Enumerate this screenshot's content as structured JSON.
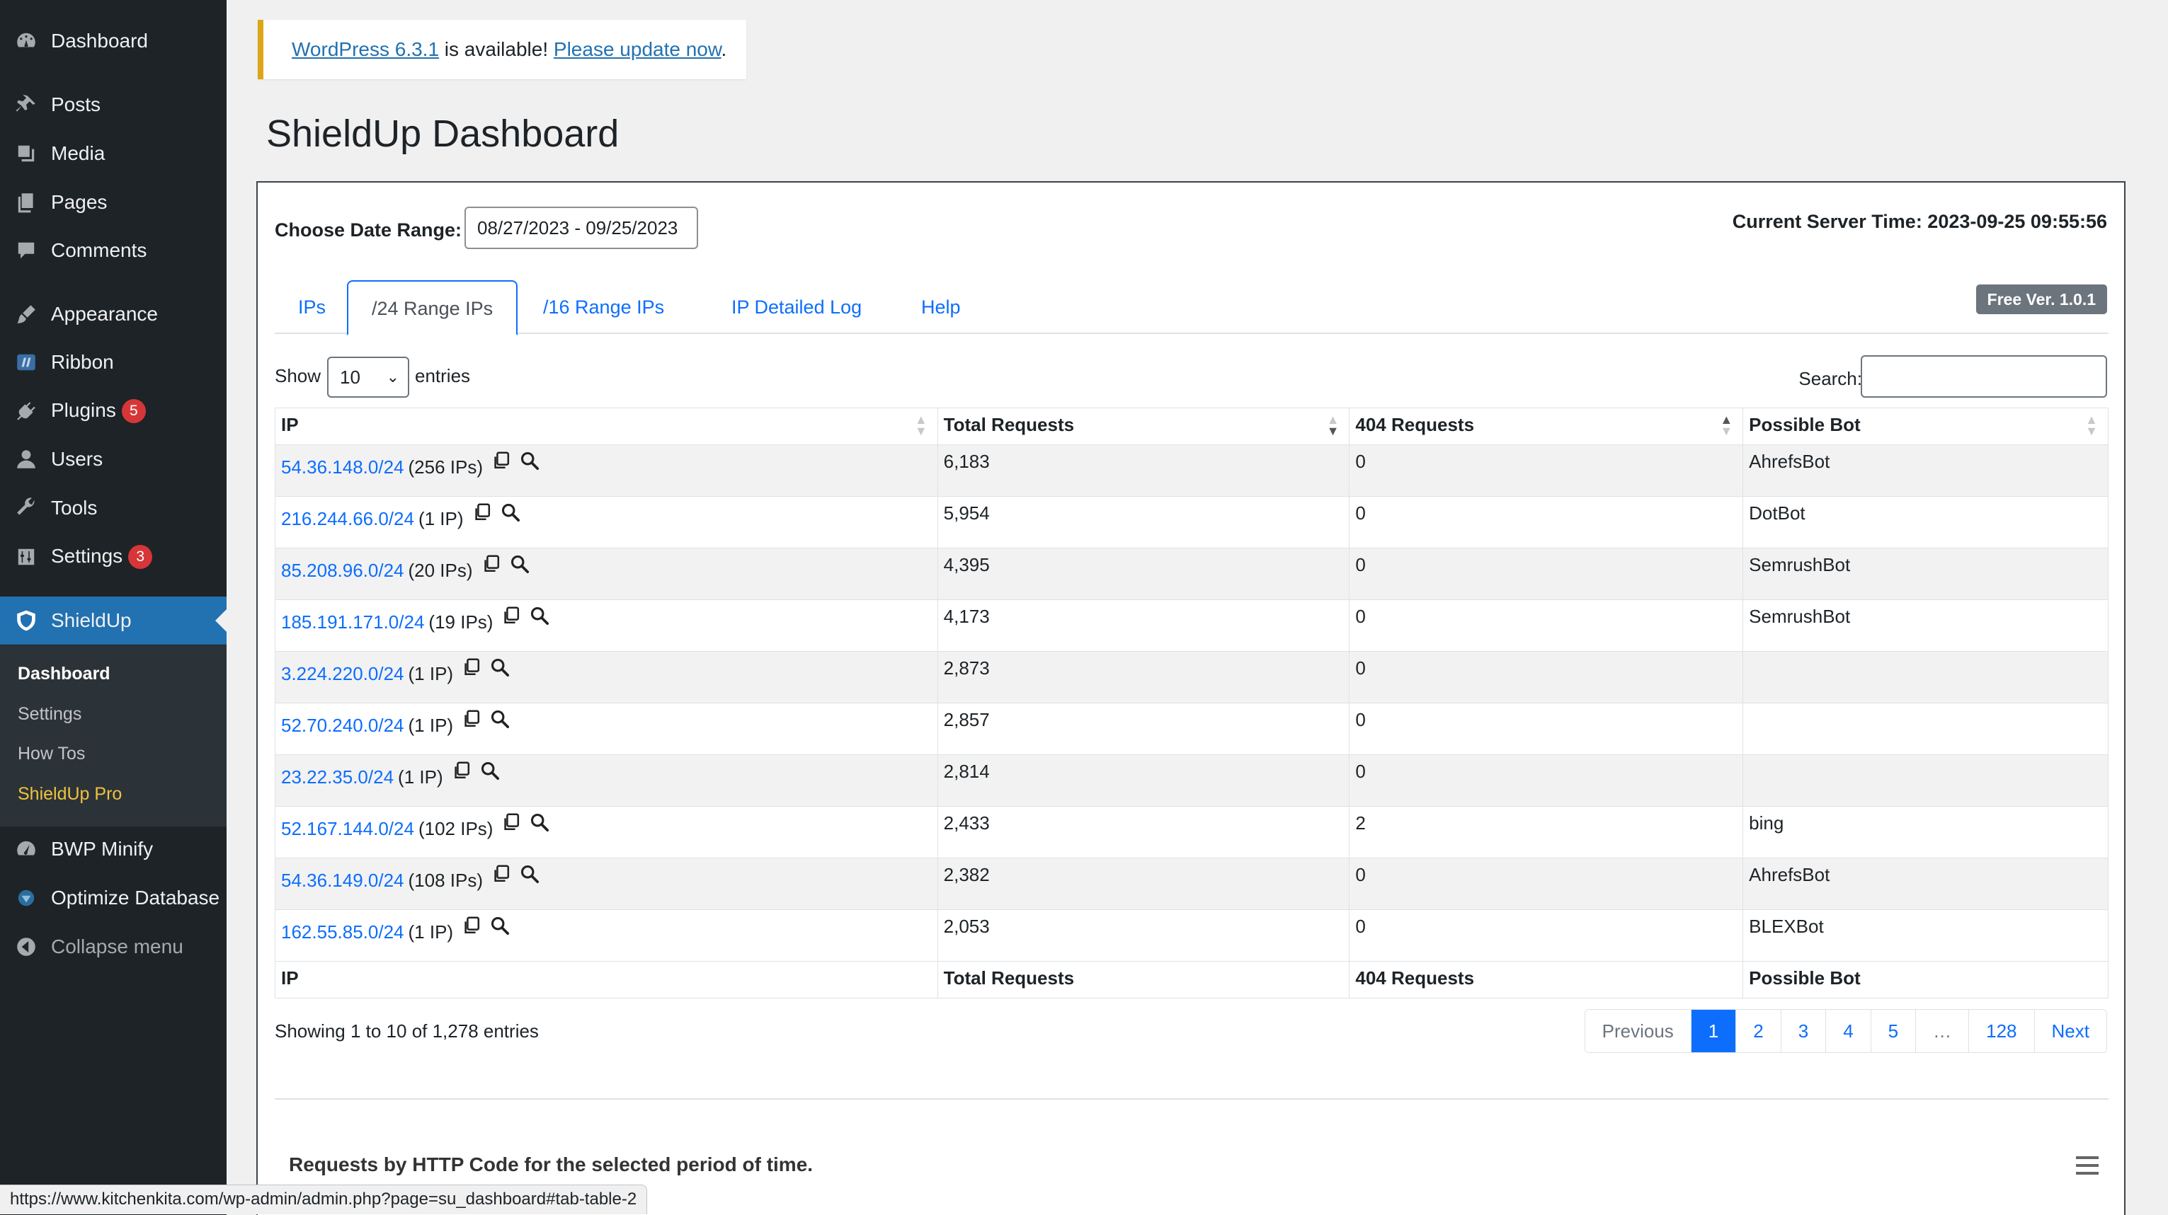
{
  "sidebar": {
    "items": [
      {
        "label": "Dashboard",
        "icon": "dashboard-icon"
      },
      {
        "label": "Posts",
        "icon": "pin-icon"
      },
      {
        "label": "Media",
        "icon": "media-icon"
      },
      {
        "label": "Pages",
        "icon": "pages-icon"
      },
      {
        "label": "Comments",
        "icon": "comment-icon"
      },
      {
        "label": "Appearance",
        "icon": "brush-icon"
      },
      {
        "label": "Ribbon",
        "icon": "ribbon-icon"
      },
      {
        "label": "Plugins",
        "icon": "plugin-icon",
        "badge": "5"
      },
      {
        "label": "Users",
        "icon": "user-icon"
      },
      {
        "label": "Tools",
        "icon": "wrench-icon"
      },
      {
        "label": "Settings",
        "icon": "sliders-icon",
        "badge": "3"
      },
      {
        "label": "ShieldUp",
        "icon": "shield-icon"
      },
      {
        "label": "BWP Minify",
        "icon": "gauge-icon"
      },
      {
        "label": "Optimize Database",
        "icon": "database-icon"
      },
      {
        "label": "Collapse menu",
        "icon": "collapse-icon"
      }
    ],
    "submenu": [
      "Dashboard",
      "Settings",
      "How Tos",
      "ShieldUp Pro"
    ]
  },
  "notice": {
    "version_link": "WordPress 6.3.1",
    "middle": " is available! ",
    "update_link": "Please update now",
    "end": "."
  },
  "page_title": "ShieldUp Dashboard",
  "controls": {
    "date_label": "Choose Date Range:",
    "date_value": "08/27/2023 - 09/25/2023",
    "server_time": "Current Server Time: 2023-09-25 09:55:56",
    "version_badge": "Free Ver. 1.0.1",
    "show_label": "Show",
    "entries_value": "10",
    "entries_label": "entries",
    "search_label": "Search:"
  },
  "tabs": [
    "IPs",
    "/24 Range IPs",
    "/16 Range IPs",
    "IP Detailed Log",
    "Help"
  ],
  "table": {
    "headers": [
      "IP",
      "Total Requests",
      "404 Requests",
      "Possible Bot"
    ],
    "rows": [
      {
        "ip": "54.36.148.0/24",
        "count": "(256 IPs)",
        "total": "6,183",
        "r404": "0",
        "bot": "AhrefsBot"
      },
      {
        "ip": "216.244.66.0/24",
        "count": "(1 IP)",
        "total": "5,954",
        "r404": "0",
        "bot": "DotBot"
      },
      {
        "ip": "85.208.96.0/24",
        "count": "(20 IPs)",
        "total": "4,395",
        "r404": "0",
        "bot": "SemrushBot"
      },
      {
        "ip": "185.191.171.0/24",
        "count": "(19 IPs)",
        "total": "4,173",
        "r404": "0",
        "bot": "SemrushBot"
      },
      {
        "ip": "3.224.220.0/24",
        "count": "(1 IP)",
        "total": "2,873",
        "r404": "0",
        "bot": ""
      },
      {
        "ip": "52.70.240.0/24",
        "count": "(1 IP)",
        "total": "2,857",
        "r404": "0",
        "bot": ""
      },
      {
        "ip": "23.22.35.0/24",
        "count": "(1 IP)",
        "total": "2,814",
        "r404": "0",
        "bot": ""
      },
      {
        "ip": "52.167.144.0/24",
        "count": "(102 IPs)",
        "total": "2,433",
        "r404": "2",
        "bot": "bing"
      },
      {
        "ip": "54.36.149.0/24",
        "count": "(108 IPs)",
        "total": "2,382",
        "r404": "0",
        "bot": "AhrefsBot"
      },
      {
        "ip": "162.55.85.0/24",
        "count": "(1 IP)",
        "total": "2,053",
        "r404": "0",
        "bot": "BLEXBot"
      }
    ]
  },
  "info": "Showing 1 to 10 of 1,278 entries",
  "pagination": [
    "Previous",
    "1",
    "2",
    "3",
    "4",
    "5",
    "…",
    "128",
    "Next"
  ],
  "chart_title": "Requests by HTTP Code for the selected period of time.",
  "status_url": "https://www.kitchenkita.com/wp-admin/admin.php?page=su_dashboard#tab-table-2",
  "colors": {
    "sidebar_bg": "#1d2327",
    "active_menu": "#2271b1",
    "link": "#0d6efd",
    "notice_accent": "#dba617",
    "badge": "#d63638"
  }
}
